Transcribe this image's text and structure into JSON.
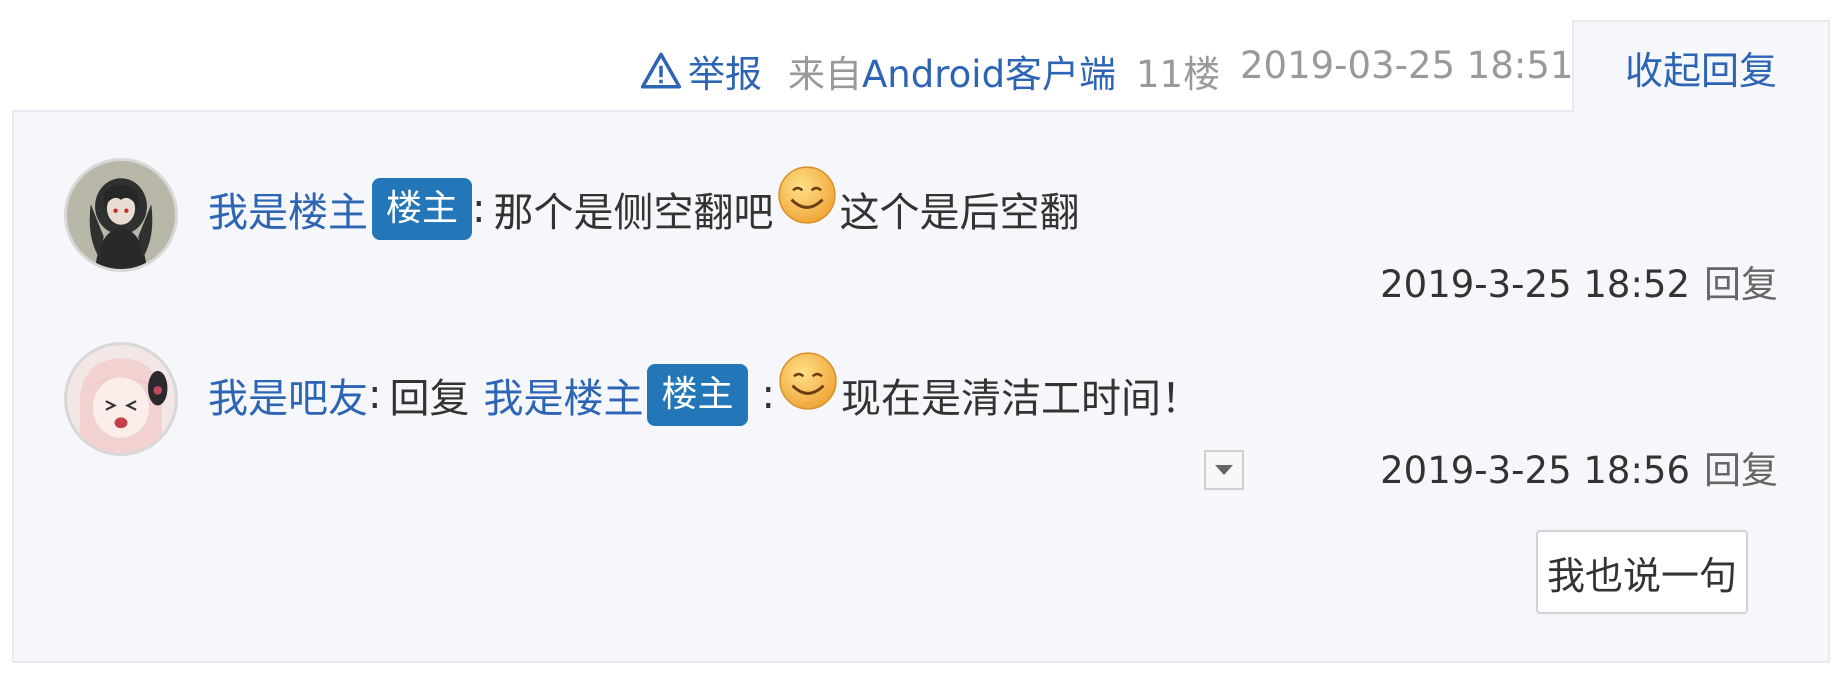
{
  "post_tail": {
    "report_label": "举报",
    "source_prefix": "来自",
    "source_client": "Android客户端",
    "floor": "11楼",
    "time": "2019-03-25 18:51",
    "toggle_label": "收起回复"
  },
  "replies": [
    {
      "user": "我是楼主",
      "badge": "楼主",
      "separator": ":",
      "text_before_emoji": "那个是侧空翻吧",
      "emoji": "smile-emoji",
      "text_after_emoji": "这个是后空翻",
      "time": "2019-3-25 18:52",
      "reply_label": "回复"
    },
    {
      "user": "我是吧友",
      "separator": ":",
      "reply_word": "回复",
      "target_user": "我是楼主",
      "target_badge": "楼主",
      "target_separator": ":",
      "emoji": "smile-emoji",
      "text_after_emoji": "现在是清洁工时间！",
      "time": "2019-3-25 18:56",
      "reply_label": "回复"
    }
  ],
  "say_button_label": "我也说一句",
  "colors": {
    "link": "#2d64b3",
    "badge": "#2376b7",
    "panel_bg": "#f5f7fa",
    "muted": "#999999"
  }
}
